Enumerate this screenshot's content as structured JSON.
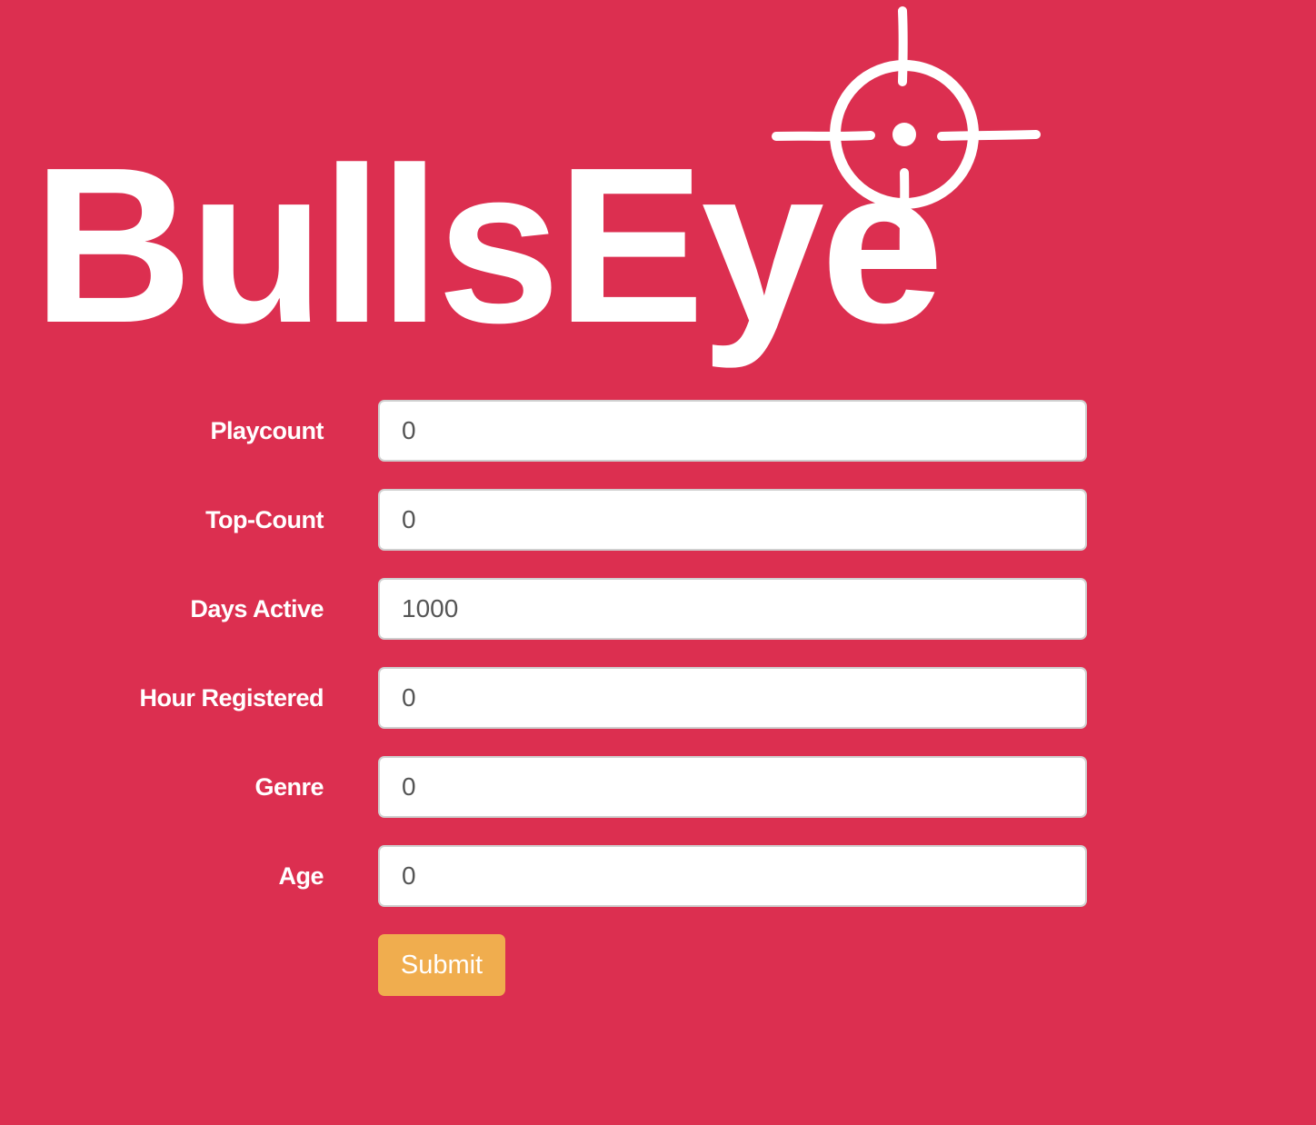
{
  "brand": {
    "name": "BullsEye",
    "logo_icon": "crosshair-icon",
    "background_color": "#dc2f50",
    "text_color": "#ffffff"
  },
  "form": {
    "fields": [
      {
        "label": "Playcount",
        "value": "0"
      },
      {
        "label": "Top-Count",
        "value": "0"
      },
      {
        "label": "Days Active",
        "value": "1000"
      },
      {
        "label": "Hour Registered",
        "value": "0"
      },
      {
        "label": "Genre",
        "value": "0"
      },
      {
        "label": "Age",
        "value": "0"
      }
    ],
    "submit_label": "Submit",
    "submit_color": "#f0ad4e"
  }
}
